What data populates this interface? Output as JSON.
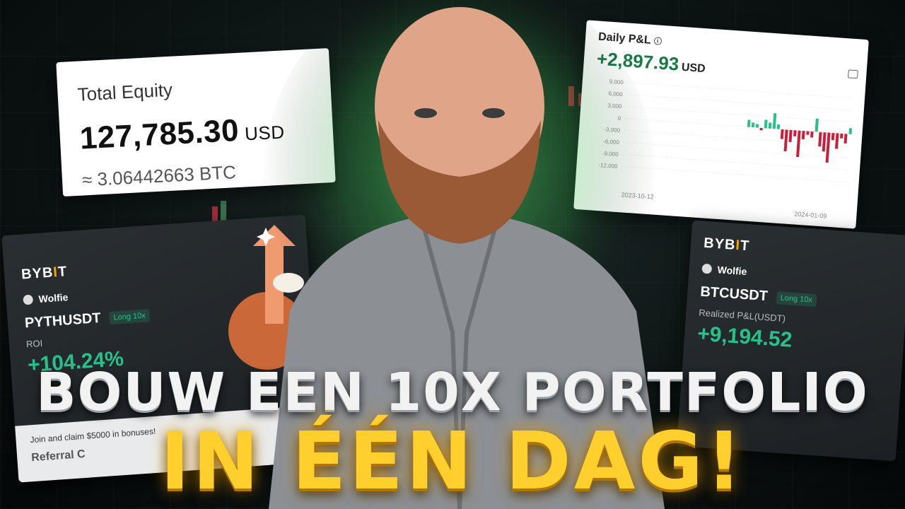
{
  "equity_card": {
    "label": "Total Equity",
    "amount": "127,785.30",
    "currency": "USD",
    "btc_value": "≈ 3.06442663 BTC"
  },
  "pnl_card": {
    "label": "Daily P&L",
    "amount": "+2,897.93",
    "currency": "USD",
    "info_icon": "i",
    "start_date": "2023-10-12",
    "end_date": "2024-01-09",
    "y_ticks": [
      "9,000",
      "6,000",
      "3,000",
      "0",
      "-3,000",
      "-6,000",
      "-9,000",
      "-12,000"
    ]
  },
  "pyth_card": {
    "brand": "BYBIT",
    "user": "Wolfie",
    "pair": "PYTHUSDT",
    "position": "Long 10x",
    "metric_label": "ROI",
    "metric_value": "+104.24%",
    "footer_text": "Join and claim $5000 in bonuses!",
    "footer_ref": "Referral C"
  },
  "btc_card": {
    "brand": "BYBIT",
    "user": "Wolfie",
    "pair": "BTCUSDT",
    "position": "Long 10x",
    "metric_label": "Realized P&L(USDT)",
    "metric_value": "+9,194.52"
  },
  "headline": {
    "line1": "BOUW EEN 10X PORTFOLIO",
    "line2": "IN ÉÉN DAG!"
  },
  "colors": {
    "profit_green": "#28c08a",
    "loss_red": "#c8203c",
    "headline_gold": "#ffcf2e",
    "glow_green": "#5cff6a"
  }
}
